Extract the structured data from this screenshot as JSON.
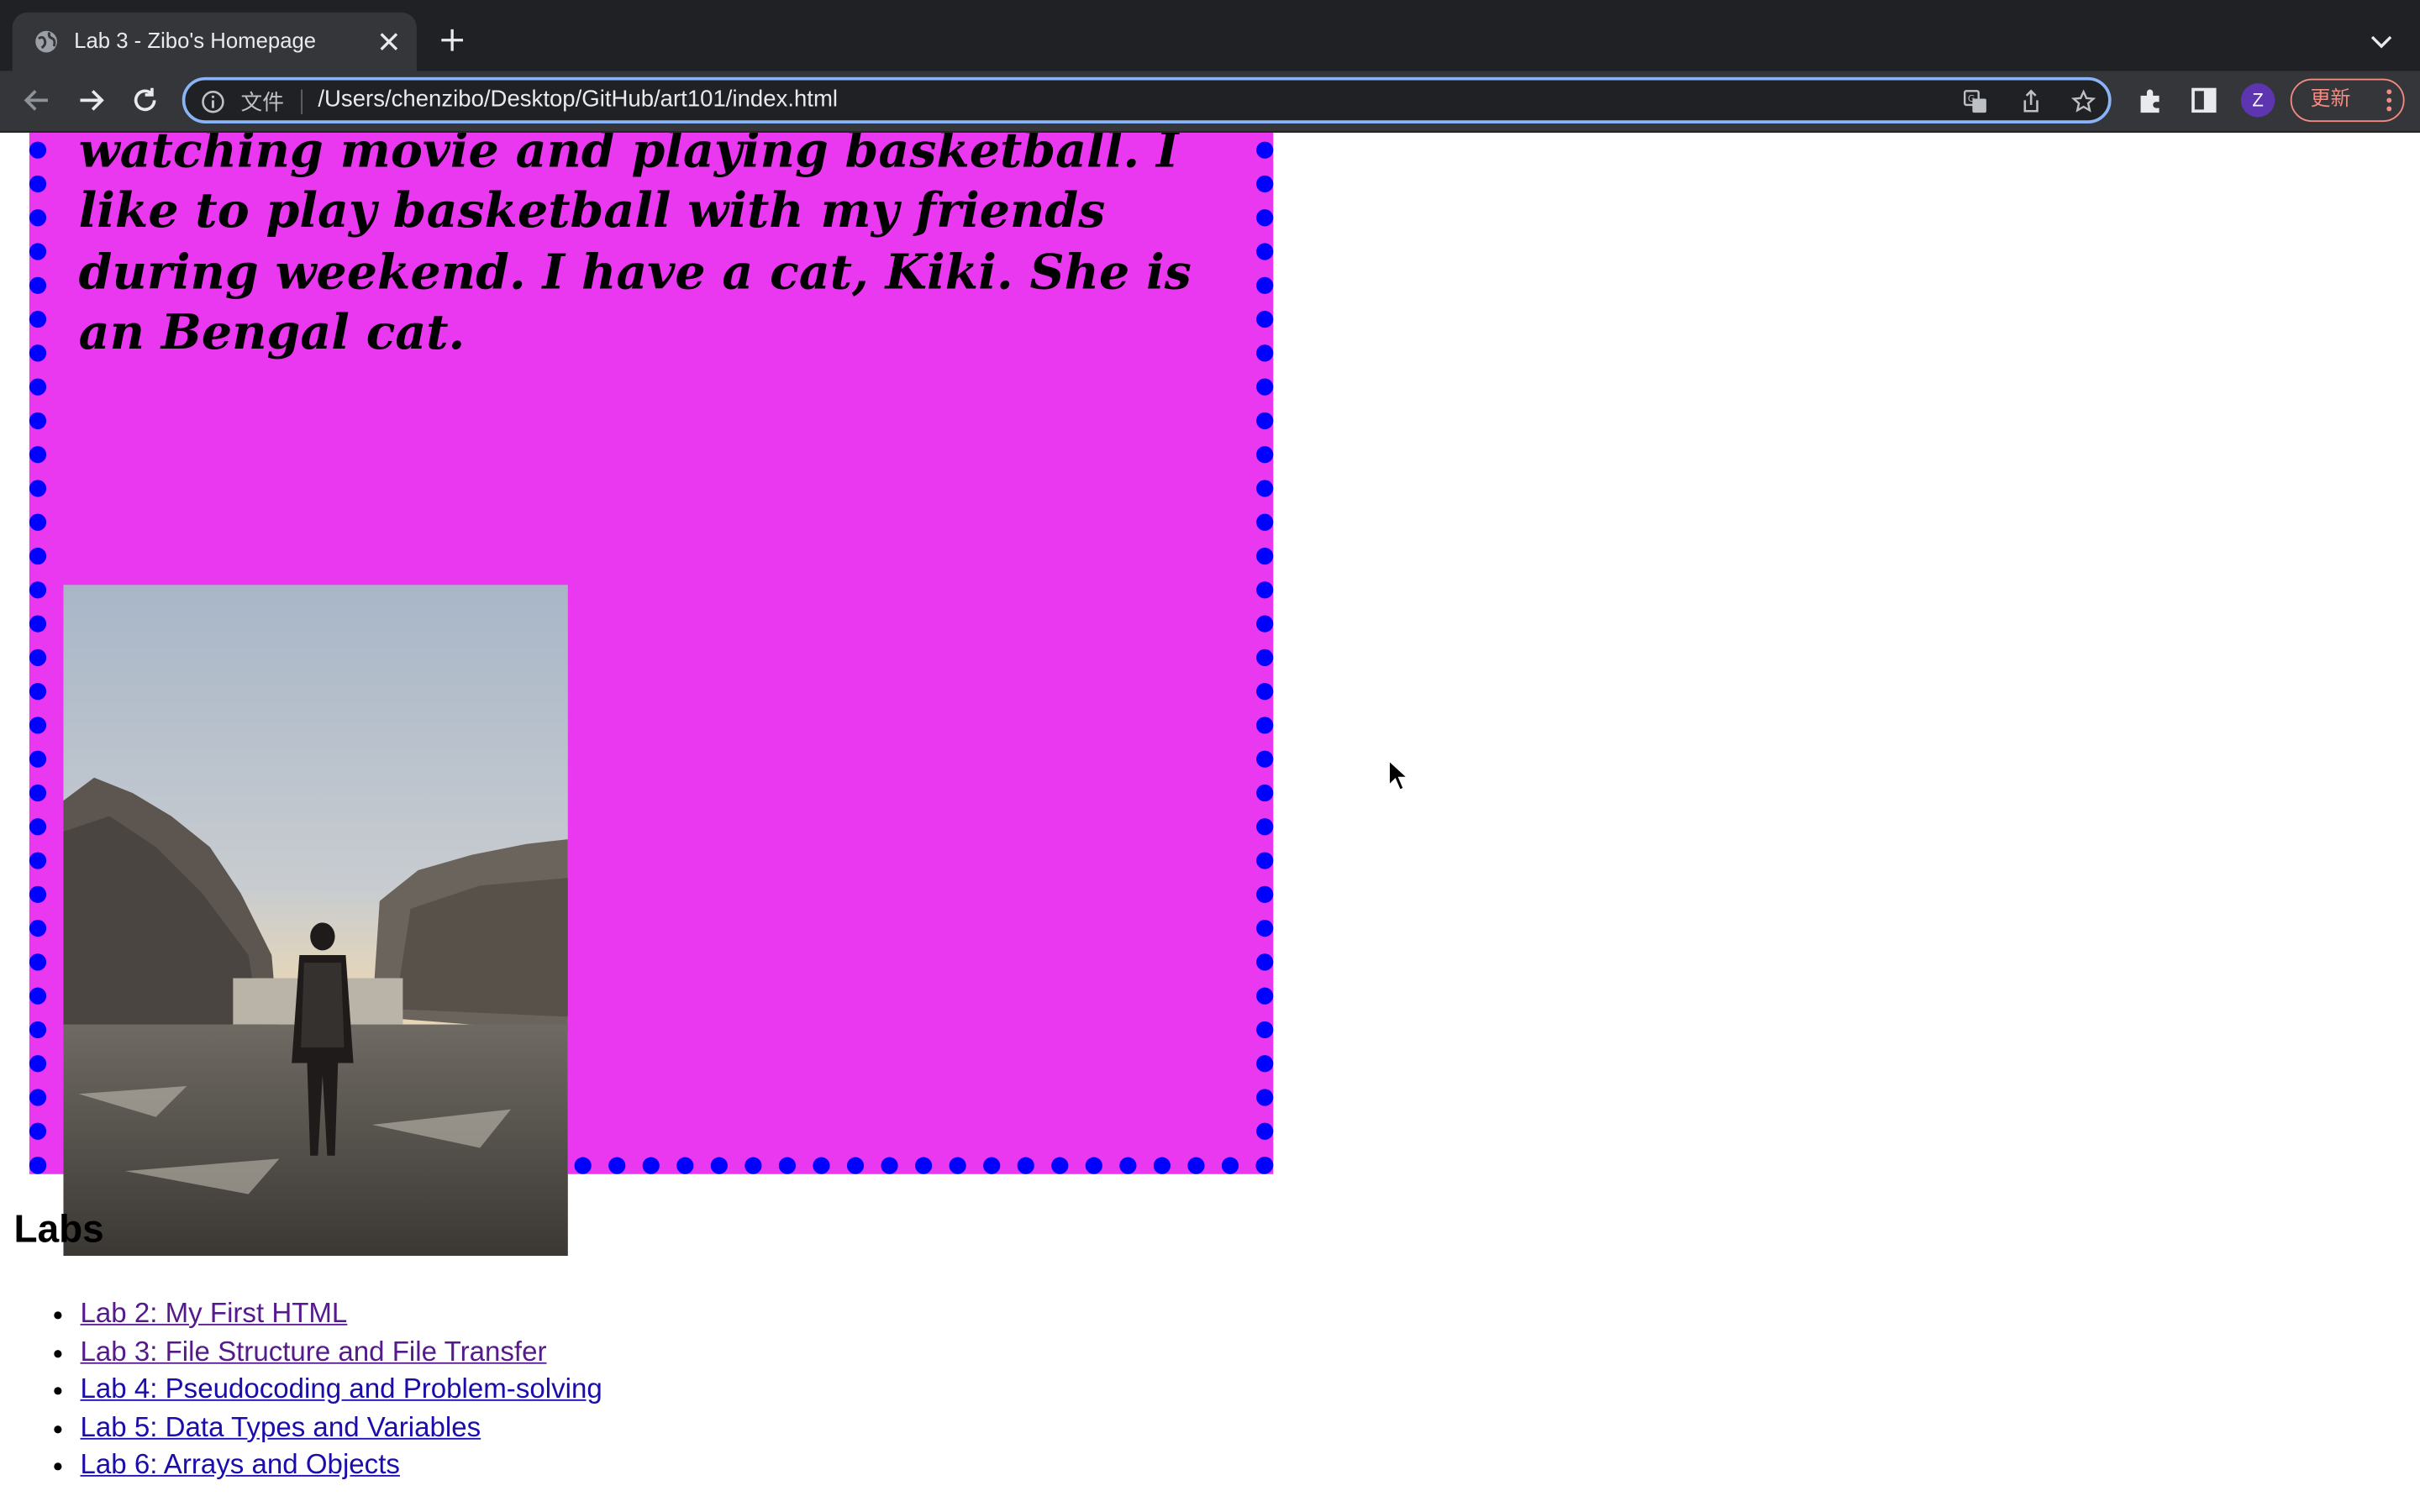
{
  "browser": {
    "tab_title": "Lab 3 - Zibo's Homepage",
    "protocol_label": "文件",
    "url": "/Users/chenzibo/Desktop/GitHub/art101/index.html",
    "profile_initial": "Z",
    "update_label": "更新"
  },
  "page": {
    "intro_text": "year film and digital media major. I like watching movie and playing basketball. I like to play basketball with my friends during weekend. I have a cat, Kiki. She is an Bengal cat.",
    "colors": {
      "box_background": "#ea38f0",
      "box_border": "#0000ff"
    },
    "labs": {
      "heading": "Labs",
      "items": [
        {
          "label": "Lab 2: My First HTML"
        },
        {
          "label": "Lab 3: File Structure and File Transfer"
        },
        {
          "label": "Lab 4: Pseudocoding and Problem-solving"
        },
        {
          "label": "Lab 5: Data Types and Variables"
        },
        {
          "label": "Lab 6: Arrays and Objects"
        }
      ]
    }
  }
}
